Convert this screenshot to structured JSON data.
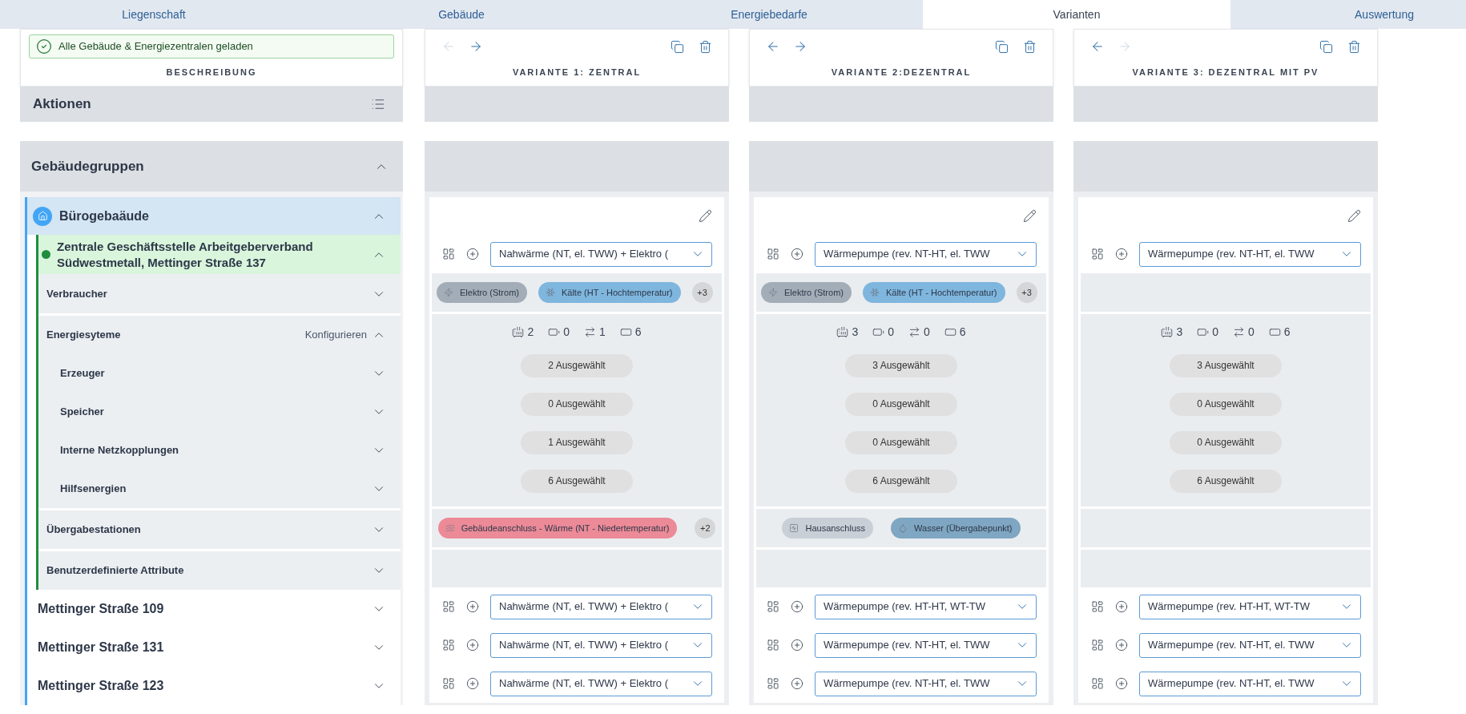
{
  "tabs": [
    {
      "label": "Liegenschaft",
      "selected": false
    },
    {
      "label": "Gebäude",
      "selected": false
    },
    {
      "label": "Energiebedarfe",
      "selected": false
    },
    {
      "label": "Varianten",
      "selected": true
    },
    {
      "label": "Auswertung",
      "selected": false
    }
  ],
  "description": {
    "alert": "Alle Gebäude & Energiezentralen geladen",
    "title": "BESCHREIBUNG"
  },
  "actions": {
    "title": "Aktionen"
  },
  "groups": {
    "title": "Gebäudegruppen",
    "expanded": true,
    "items": [
      {
        "name": "Bürogebaäude",
        "expanded": true,
        "children": [
          {
            "name": "Zentrale Geschäftsstelle Arbeitgeberverband Südwestmetall, Mettinger Straße 137",
            "expanded": true,
            "sections": [
              {
                "label": "Verbraucher",
                "expanded": false
              },
              {
                "label": "Energiesyteme",
                "action": "Konfigurieren",
                "expanded": true,
                "children": [
                  {
                    "label": "Erzeuger",
                    "expanded": false
                  },
                  {
                    "label": "Speicher",
                    "expanded": false
                  },
                  {
                    "label": "Interne Netzkopplungen",
                    "expanded": false
                  },
                  {
                    "label": "Hilfsenergien",
                    "expanded": false
                  }
                ]
              },
              {
                "label": "Übergabestationen",
                "expanded": false
              },
              {
                "label": "Benutzerdefinierte Attribute",
                "expanded": false
              }
            ]
          },
          {
            "name": "Mettinger Straße 109",
            "expanded": false
          },
          {
            "name": "Mettinger Straße 131",
            "expanded": false
          },
          {
            "name": "Mettinger Straße 123",
            "expanded": false
          }
        ]
      }
    ]
  },
  "variants": [
    {
      "title": "VARIANTE 1: ZENTRAL",
      "prev_disabled": true,
      "next_disabled": false,
      "system": "Nahwärme (NT, el. TWW) + Elektro (",
      "consumers": {
        "chips": [
          {
            "label": "Elektro (Strom)",
            "kind": "electric",
            "color": "#a3adb8"
          },
          {
            "label": "Kälte (HT - Hochtemperatur)",
            "kind": "cold",
            "color": "#7fb6de"
          }
        ],
        "more": "+3"
      },
      "counts": [
        {
          "kind": "generator",
          "value": "2"
        },
        {
          "kind": "storage",
          "value": "0"
        },
        {
          "kind": "coupling",
          "value": "1"
        },
        {
          "kind": "auxiliary",
          "value": "6"
        }
      ],
      "selections": [
        "2 Ausgewählt",
        "0 Ausgewählt",
        "1 Ausgewählt",
        "6 Ausgewählt"
      ],
      "stations": {
        "chips": [
          {
            "label": "Gebäudeanschluss - Wärme (NT - Niedertemperatur)",
            "kind": "heat",
            "color": "#ec8a98"
          }
        ],
        "more": "+2"
      },
      "buildings": [
        "Nahwärme (NT, el. TWW) + Elektro (",
        "Nahwärme (NT, el. TWW) + Elektro (",
        "Nahwärme (NT, el. TWW) + Elektro ("
      ]
    },
    {
      "title": "VARIANTE 2:DEZENTRAL",
      "prev_disabled": false,
      "next_disabled": false,
      "system": "Wärmepumpe (rev. NT-HT, el. TWW",
      "consumers": {
        "chips": [
          {
            "label": "Elektro (Strom)",
            "kind": "electric",
            "color": "#a3adb8"
          },
          {
            "label": "Kälte (HT - Hochtemperatur)",
            "kind": "cold",
            "color": "#7fb6de"
          }
        ],
        "more": "+3"
      },
      "counts": [
        {
          "kind": "generator",
          "value": "3"
        },
        {
          "kind": "storage",
          "value": "0"
        },
        {
          "kind": "coupling",
          "value": "0"
        },
        {
          "kind": "auxiliary",
          "value": "6"
        }
      ],
      "selections": [
        "3 Ausgewählt",
        "0 Ausgewählt",
        "0 Ausgewählt",
        "6 Ausgewählt"
      ],
      "stations": {
        "chips": [
          {
            "label": "Hausanschluss",
            "kind": "house",
            "color": "#c9cfd6"
          },
          {
            "label": "Wasser (Übergabepunkt)",
            "kind": "water",
            "color": "#7fa6c2"
          }
        ]
      },
      "buildings": [
        "Wärmepumpe (rev. HT-HT, WT-TW",
        "Wärmepumpe (rev. NT-HT, el. TWW",
        "Wärmepumpe (rev. NT-HT, el. TWW"
      ]
    },
    {
      "title": "VARIANTE 3: DEZENTRAL MIT PV",
      "prev_disabled": false,
      "next_disabled": true,
      "system": "Wärmepumpe (rev. NT-HT, el. TWW",
      "counts": [
        {
          "kind": "generator",
          "value": "3"
        },
        {
          "kind": "storage",
          "value": "0"
        },
        {
          "kind": "coupling",
          "value": "0"
        },
        {
          "kind": "auxiliary",
          "value": "6"
        }
      ],
      "selections": [
        "3 Ausgewählt",
        "0 Ausgewählt",
        "0 Ausgewählt",
        "6 Ausgewählt"
      ],
      "buildings": [
        "Wärmepumpe (rev. HT-HT, WT-TW",
        "Wärmepumpe (rev. NT-HT, el. TWW",
        "Wärmepumpe (rev. NT-HT, el. TWW"
      ]
    }
  ]
}
